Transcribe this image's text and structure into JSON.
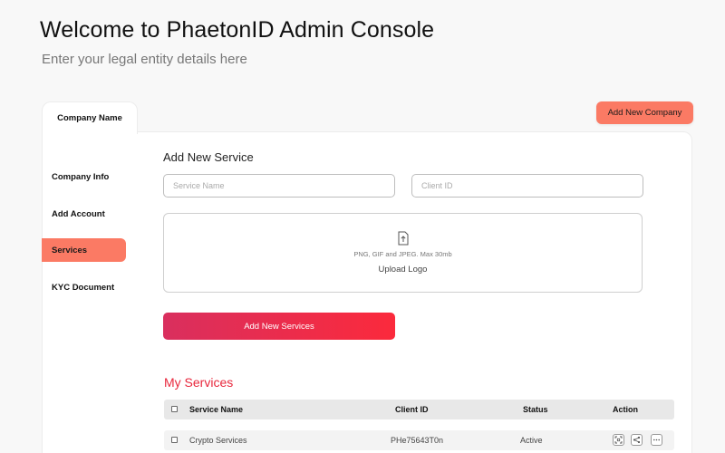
{
  "header": {
    "title": "Welcome to PhaetonID Admin Console",
    "subtitle": "Enter your legal entity details here"
  },
  "tabs": {
    "company_name": "Company Name"
  },
  "add_company_button": "Add New Company",
  "sidebar": {
    "items": [
      {
        "label": "Company Info",
        "active": false
      },
      {
        "label": "Add Account",
        "active": false
      },
      {
        "label": "Services",
        "active": true
      },
      {
        "label": "KYC Document",
        "active": false
      }
    ]
  },
  "form": {
    "title": "Add New Service",
    "service_name_placeholder": "Service Name",
    "service_name_value": "",
    "client_id_placeholder": "Client ID",
    "client_id_value": "",
    "upload_icon": "file-upload-icon",
    "upload_hint": "PNG, GIF and JPEG. Max 30mb",
    "upload_label": "Upload Logo",
    "submit_label": "Add New Services"
  },
  "services": {
    "title": "My Services",
    "columns": [
      "Service Name",
      "Client ID",
      "Status",
      "Action"
    ],
    "rows": [
      {
        "service_name": "Crypto Services",
        "client_id": "PHe75643T0n",
        "status": "Active"
      }
    ],
    "action_icons": [
      "scan-icon",
      "share-icon",
      "more-icon"
    ]
  },
  "colors": {
    "accent": "#fb7a64",
    "primary_gradient_start": "#d92f5e",
    "primary_gradient_end": "#fb2a3c",
    "section_title": "#e8283d"
  }
}
